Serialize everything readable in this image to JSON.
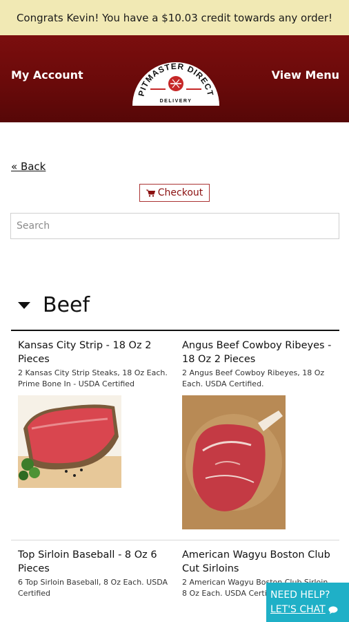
{
  "banner": {
    "text": "Congrats Kevin! You have a $10.03 credit towards any order!"
  },
  "header": {
    "my_account": "My Account",
    "view_menu": "View Menu",
    "logo": {
      "name": "PITMASTER DIRECT",
      "sub": "DELIVERY"
    }
  },
  "nav": {
    "back": "« Back",
    "checkout": "Checkout"
  },
  "search": {
    "placeholder": "Search",
    "value": ""
  },
  "section": {
    "title": "Beef"
  },
  "products": [
    {
      "name": "Kansas City Strip - 18 Oz 2 Pieces",
      "desc": "2 Kansas City Strip Steaks, 18 Oz Each. Prime Bone In - USDA Certified"
    },
    {
      "name": "Angus Beef Cowboy Ribeyes - 18 Oz 2 Pieces",
      "desc": "2 Angus Beef Cowboy Ribeyes, 18 Oz Each. USDA Certified."
    },
    {
      "name": "Top Sirloin Baseball - 8 Oz 6 Pieces",
      "desc": "6 Top Sirloin Baseball, 8 Oz Each. USDA Certified"
    },
    {
      "name": "American Wagyu Boston Club Cut Sirloins",
      "desc": "2 American Wagyu Boston Club Sirloin 8 Oz Each. USDA Certi"
    }
  ],
  "chat": {
    "line1": "NEED HELP?",
    "line2": "LET'S CHAT"
  },
  "colors": {
    "header": "#6a0a0a",
    "banner": "#f1e9b4",
    "chat": "#1fb0c7",
    "accent": "#8b1010"
  }
}
